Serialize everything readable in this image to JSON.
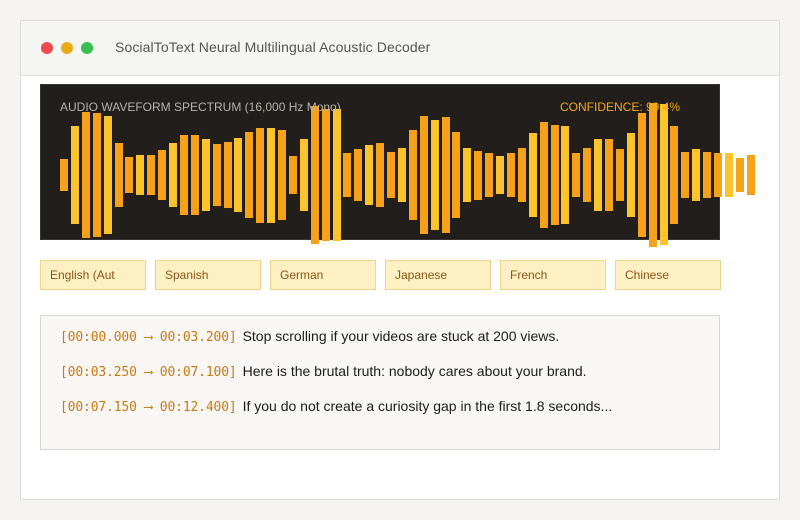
{
  "window": {
    "title": "SocialToText Neural Multilingual Acoustic Decoder",
    "controls": [
      "close",
      "minimize",
      "maximize"
    ]
  },
  "spectrum": {
    "label": "AUDIO WAVEFORM SPECTRUM (16,000 Hz Mono)",
    "confidence_label": "CONFIDENCE: 99.4%",
    "bar_levels": [
      0.22,
      0.68,
      0.88,
      0.86,
      0.82,
      0.44,
      0.25,
      0.28,
      0.28,
      0.35,
      0.45,
      0.55,
      0.56,
      0.5,
      0.43,
      0.46,
      0.52,
      0.6,
      0.66,
      0.66,
      0.62,
      0.26,
      0.5,
      0.96,
      0.92,
      0.92,
      0.3,
      0.36,
      0.42,
      0.44,
      0.32,
      0.38,
      0.62,
      0.82,
      0.76,
      0.8,
      0.6,
      0.38,
      0.34,
      0.3,
      0.26,
      0.3,
      0.38,
      0.58,
      0.74,
      0.7,
      0.68,
      0.3,
      0.38,
      0.5,
      0.5,
      0.36,
      0.58,
      0.86,
      1.0,
      0.98,
      0.68,
      0.32,
      0.36,
      0.32,
      0.3,
      0.3,
      0.24,
      0.28
    ],
    "colors": {
      "background": "#211e1b",
      "bar_primary": "#f5a21a",
      "bar_secondary": "#fbc42c",
      "confidence": "#f1a81d"
    }
  },
  "languages": [
    {
      "label": "English (Aut"
    },
    {
      "label": "Spanish"
    },
    {
      "label": "German"
    },
    {
      "label": "Japanese"
    },
    {
      "label": "French"
    },
    {
      "label": "Chinese"
    }
  ],
  "transcript": [
    {
      "timestamp": "[00:00.000 ⟶ 00:03.200]",
      "text": "Stop scrolling if your videos are stuck at 200 views."
    },
    {
      "timestamp": "[00:03.250 ⟶ 00:07.100]",
      "text": "Here is the brutal truth: nobody cares about your brand."
    },
    {
      "timestamp": "[00:07.150 ⟶ 00:12.400]",
      "text": "If you do not create a curiosity gap in the first 1.8 seconds..."
    }
  ]
}
